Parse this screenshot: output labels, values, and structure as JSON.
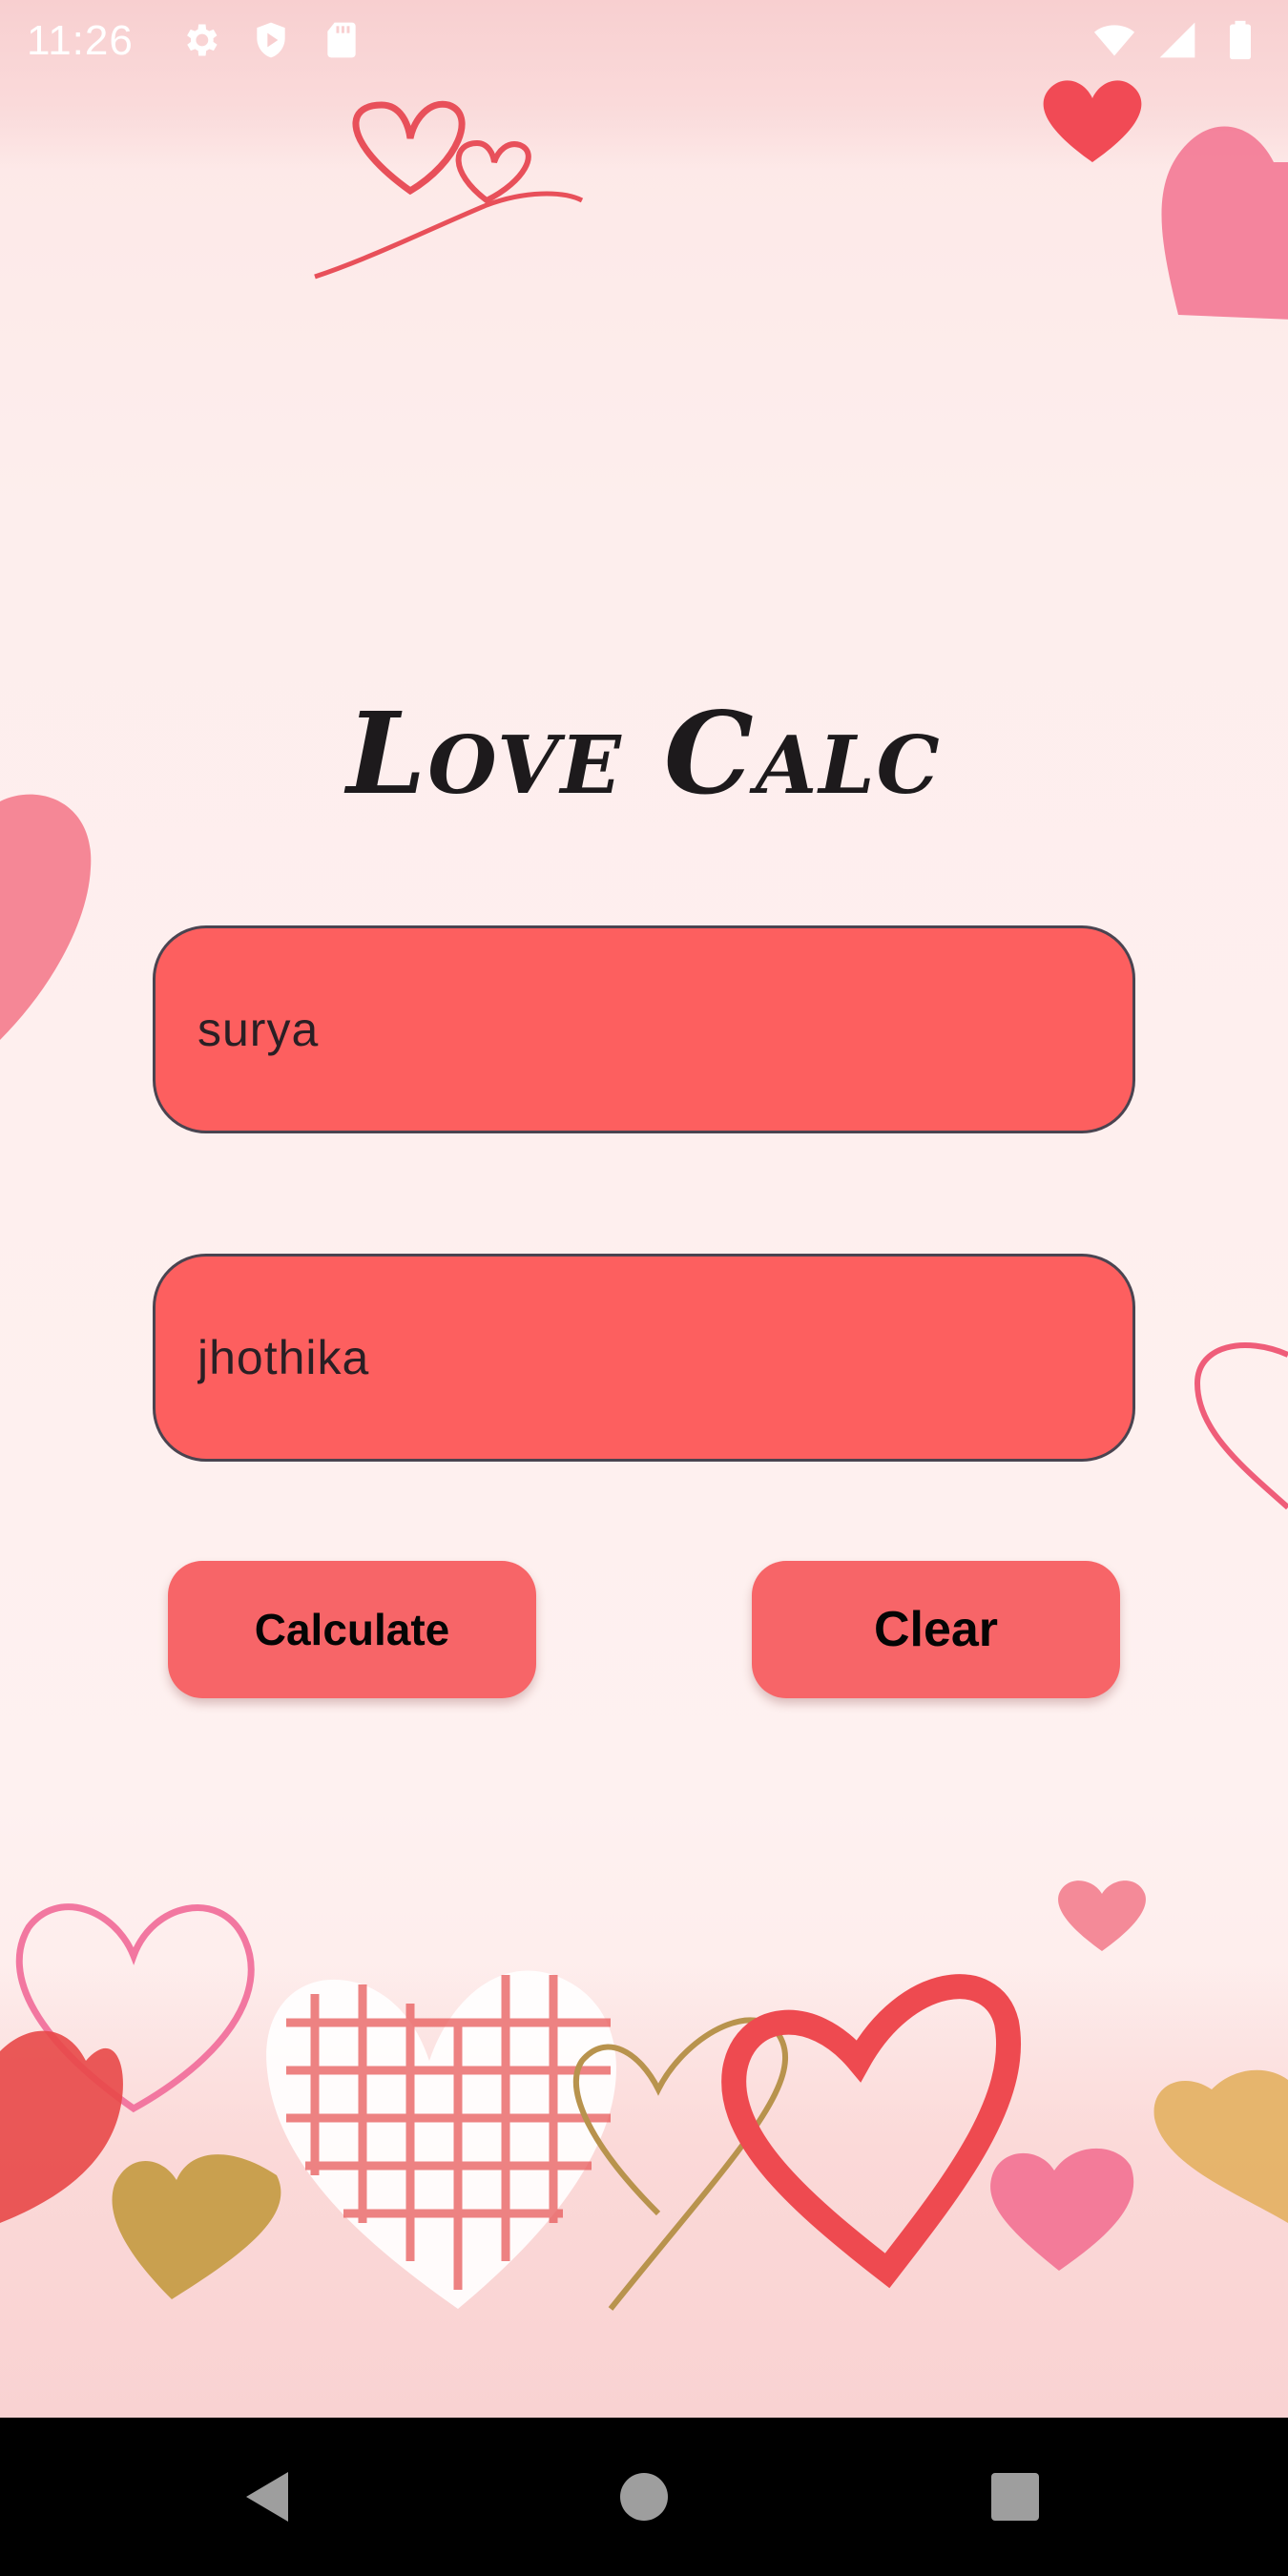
{
  "status_bar": {
    "time": "11:26",
    "left_icons": [
      "gear-icon",
      "play-protect-icon",
      "sd-card-icon"
    ],
    "right_icons": [
      "wifi-icon",
      "cell-signal-icon",
      "battery-icon"
    ]
  },
  "app": {
    "title": "Love Calc"
  },
  "form": {
    "name1_value": "surya",
    "name2_value": "jhothika"
  },
  "buttons": {
    "calculate_label": "Calculate",
    "clear_label": "Clear"
  },
  "nav_bar": {
    "icons": [
      "back-icon",
      "home-icon",
      "recents-icon"
    ]
  },
  "colors": {
    "field_fill": "#fd5f5f",
    "button_fill": "#f76568",
    "background": "#fdeeed",
    "title": "#1d1a1c"
  }
}
